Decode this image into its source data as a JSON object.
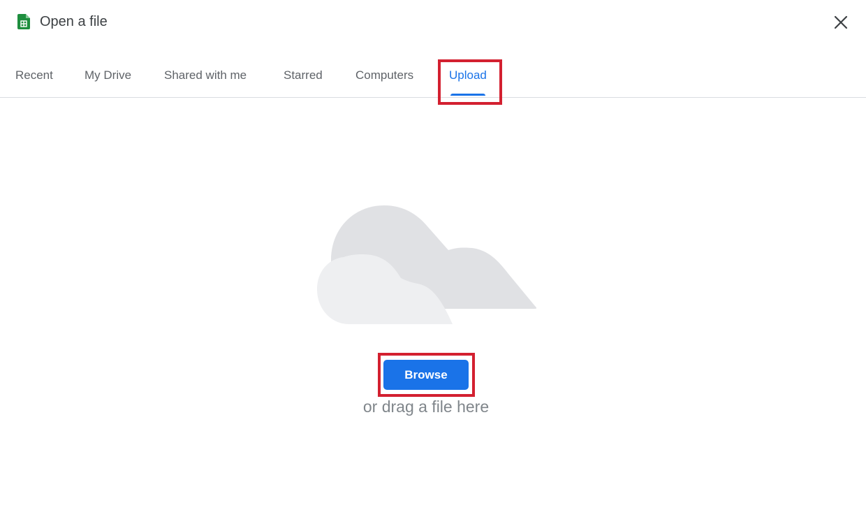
{
  "dialog": {
    "title": "Open a file",
    "app_icon": "google-sheets-icon",
    "close_icon": "close-icon"
  },
  "tabs": [
    {
      "label": "Recent",
      "active": false
    },
    {
      "label": "My Drive",
      "active": false
    },
    {
      "label": "Shared with me",
      "active": false
    },
    {
      "label": "Starred",
      "active": false
    },
    {
      "label": "Computers",
      "active": false
    },
    {
      "label": "Upload",
      "active": true
    }
  ],
  "upload": {
    "illustration": "cloud-illustration",
    "browse_label": "Browse",
    "drag_text": "or drag a file here"
  },
  "colors": {
    "accent": "#1a73e8",
    "highlight": "#d32030",
    "sheets_green": "#1e8e3e"
  }
}
